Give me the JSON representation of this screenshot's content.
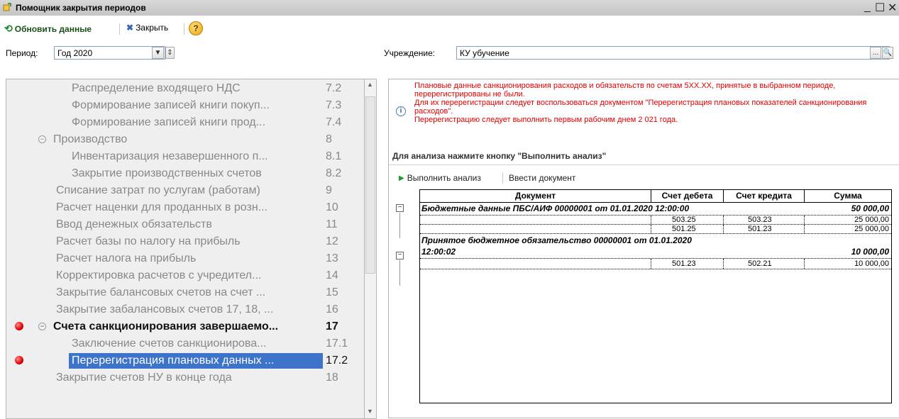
{
  "window": {
    "title": "Помощник закрытия периодов"
  },
  "toolbar": {
    "refresh_label": "Обновить данные",
    "close_label": "Закрыть",
    "help": "?"
  },
  "filters": {
    "period_label": "Период:",
    "period_value": "Год 2020",
    "institution_label": "Учреждение:",
    "institution_value": "КУ убучение"
  },
  "tree": [
    {
      "label": "Распределение входящего НДС",
      "num": "7.2"
    },
    {
      "label": "Формирование записей книги покуп...",
      "num": "7.3"
    },
    {
      "label": "Формирование записей книги прод...",
      "num": "7.4"
    },
    {
      "label": "Производство",
      "num": "8"
    },
    {
      "label": "Инвентаризация незавершенного п...",
      "num": "8.1"
    },
    {
      "label": "Закрытие производственных счетов",
      "num": "8.2"
    },
    {
      "label": "Списание затрат по услугам (работам)",
      "num": "9"
    },
    {
      "label": "Расчет наценки для проданных в розн...",
      "num": "10"
    },
    {
      "label": "Ввод денежных обязательств",
      "num": "11"
    },
    {
      "label": "Расчет базы по налогу на прибыль",
      "num": "12"
    },
    {
      "label": "Расчет налога на прибыль",
      "num": "13"
    },
    {
      "label": "Корректировка расчетов с учредител...",
      "num": "14"
    },
    {
      "label": "Закрытие балансовых счетов на счет ...",
      "num": "15"
    },
    {
      "label": "Закрытие забалансовых счетов 17, 18, ...",
      "num": "16"
    },
    {
      "label": "Счета санкционирования завершаемо...",
      "num": "17"
    },
    {
      "label": "Заключение счетов санкционирова...",
      "num": "17.1"
    },
    {
      "label": "Перерегистрация плановых данных ...",
      "num": "17.2"
    },
    {
      "label": "Закрытие счетов НУ в конце года",
      "num": "18"
    }
  ],
  "message": {
    "line1": "Плановые данные санкционирования расходов и обязательств по счетам 5ХХ.ХХ, принятые в выбранном периоде, перерегистрированы не были.",
    "line2": "Для их перерегистрации следует воспользоваться документом \"Перерегистрация плановых показателей санкционирования расходов\".",
    "line3": "Перерегистрацию следует выполнить первым рабочим днем 2 021 года."
  },
  "analysis": {
    "header": "Для анализа нажмите кнопку \"Выполнить анализ\"",
    "run_label": "Выполнить анализ",
    "enter_label": "Ввести документ"
  },
  "grid": {
    "columns": [
      "Документ",
      "Счет дебета",
      "Счет кредита",
      "Сумма"
    ],
    "groups": [
      {
        "document": "Бюджетные данные ПБС/АИФ 00000001 от 01.01.2020 12:00:00",
        "sum": "50 000,00",
        "rows": [
          {
            "debit": "503.25",
            "credit": "503.23",
            "sum": "25 000,00"
          },
          {
            "debit": "501.25",
            "credit": "501.23",
            "sum": "25 000,00"
          }
        ]
      },
      {
        "document_line1": "Принятое бюджетное обязательство 00000001 от 01.01.2020",
        "document_line2": "12:00:02",
        "sum": "10 000,00",
        "rows": [
          {
            "debit": "501.23",
            "credit": "502.21",
            "sum": "10 000,00"
          }
        ]
      }
    ]
  }
}
